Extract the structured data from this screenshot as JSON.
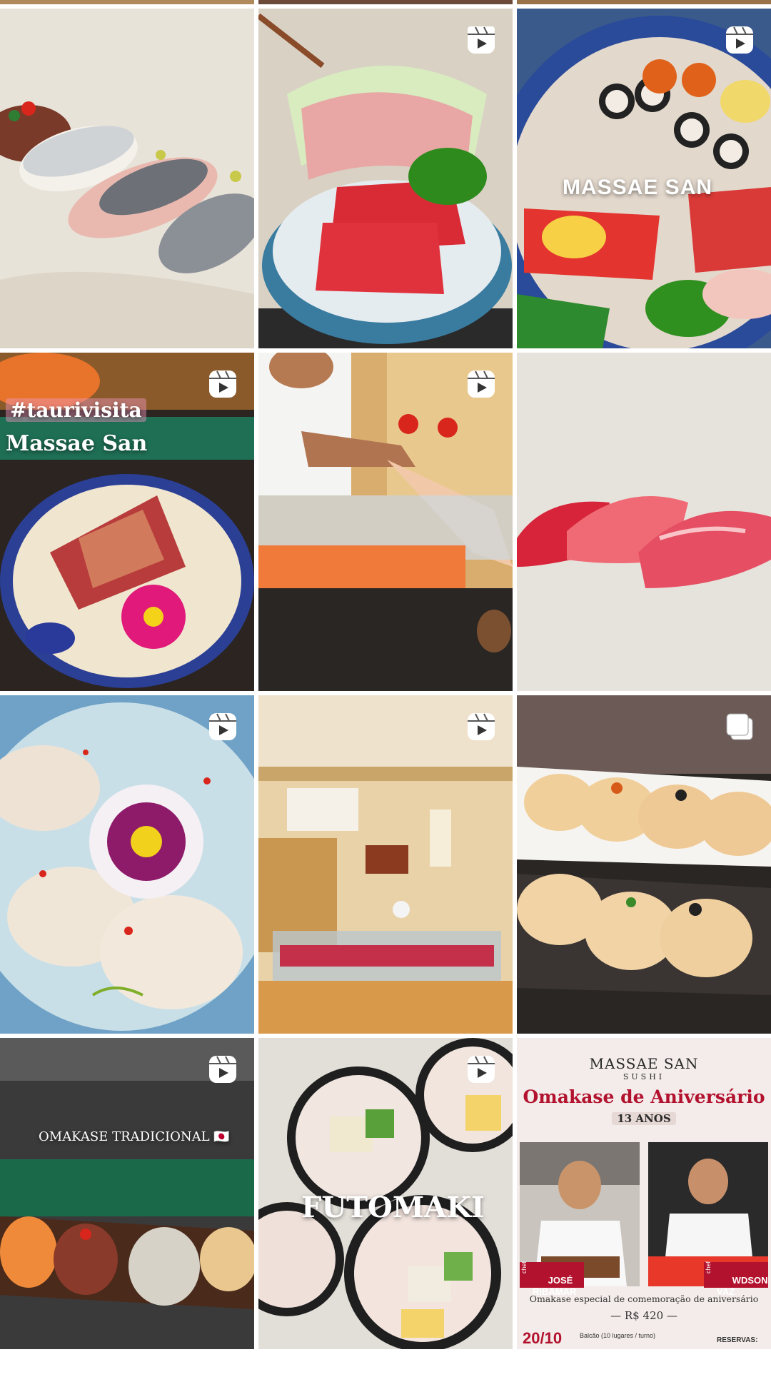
{
  "grid": {
    "tiles": [
      {
        "name": "post-sushi-nigiri-mackerel",
        "badge": "none"
      },
      {
        "name": "post-sashimi-tuna-bowl",
        "badge": "reel"
      },
      {
        "name": "post-massae-san-platter",
        "badge": "reel",
        "overlay": "MASSAE SAN"
      },
      {
        "name": "post-taurivisita",
        "badge": "reel",
        "overlay_tag": "#taurivisita",
        "overlay_title": "Massae San"
      },
      {
        "name": "post-chef-serving",
        "badge": "reel"
      },
      {
        "name": "post-tuna-nigiri",
        "badge": "none"
      },
      {
        "name": "post-carpaccio-flower",
        "badge": "reel"
      },
      {
        "name": "post-restaurant-interior",
        "badge": "reel"
      },
      {
        "name": "post-scallop-nigiri",
        "badge": "carousel"
      },
      {
        "name": "post-omakase-tradicional",
        "badge": "reel",
        "overlay": "OMAKASE TRADICIONAL 🇯🇵"
      },
      {
        "name": "post-futomaki",
        "badge": "reel",
        "overlay": "FUTOMAKI"
      },
      {
        "name": "post-omakase-aniversario",
        "badge": "none"
      }
    ]
  },
  "poster": {
    "brand": "MASSAE SAN",
    "brand_sub": "SUSHI",
    "title": "Omakase de Aniversário",
    "years": "13 ANOS",
    "chef1_prefix": "chef",
    "chef1": "JOSÉ\nRIBAMAR",
    "chef2_prefix": "chef",
    "chef2": "WDSON\nVAZ",
    "desc": "Omakase especial de comemoração de aniversário",
    "price": "— R$ 420 —",
    "date": "20/10",
    "seats": "Balcão (10 lugares / turno)",
    "reserve": "RESERVAS:"
  },
  "colors": {
    "poster_red": "#b3122e",
    "poster_bg": "#f3ecea",
    "badge": "#ffffff"
  }
}
